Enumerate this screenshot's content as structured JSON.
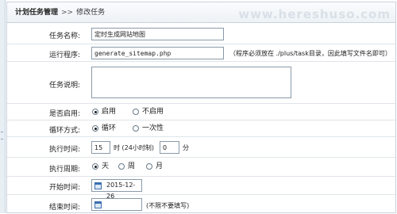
{
  "breadcrumb": {
    "section": "计划任务管理",
    "separator": ">>",
    "page": "修改任务"
  },
  "watermark": "www.hereshuso.com",
  "form": {
    "task_name": {
      "label": "任务名称:",
      "value": "定时生成网站地图"
    },
    "program": {
      "label": "运行程序:",
      "value": "generate_sitemap.php",
      "hint": "（程序必须放在 ./plus/task目录，因此填写文件名即可）"
    },
    "description": {
      "label": "任务说明:",
      "value": ""
    },
    "enabled": {
      "label": "是否启用:",
      "options": [
        "启用",
        "不启用"
      ],
      "selected": 0
    },
    "loop_mode": {
      "label": "循环方式:",
      "options": [
        "循环",
        "一次性"
      ],
      "selected": 0
    },
    "run_time": {
      "label": "执行时间:",
      "hour": "15",
      "hour_unit": "时 (24小时制)",
      "minute": "0",
      "minute_unit": "分"
    },
    "period": {
      "label": "执行周期:",
      "options": [
        "天",
        "周",
        "月"
      ],
      "selected": 0
    },
    "start_time": {
      "label": "开始时间:",
      "value": "2015-12-26"
    },
    "end_time": {
      "label": "结束时间:",
      "value": "",
      "hint": "(不限不要填写)"
    }
  }
}
